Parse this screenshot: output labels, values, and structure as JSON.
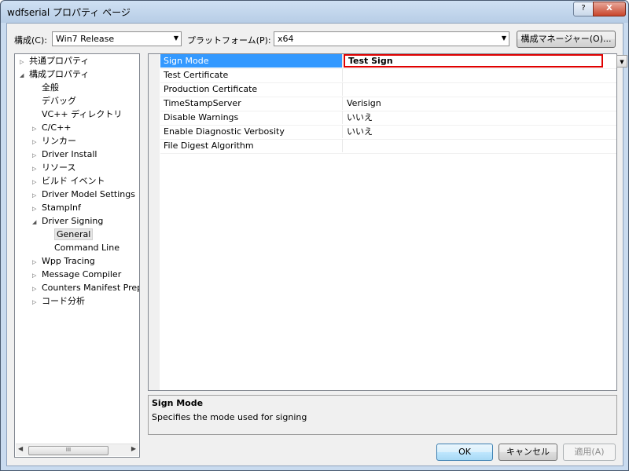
{
  "window": {
    "title": "wdfserial プロパティ ページ",
    "help": "?",
    "close": "X"
  },
  "toolbar": {
    "config_label": "構成(C):",
    "config_value": "Win7 Release",
    "platform_label": "プラットフォーム(P):",
    "platform_value": "x64",
    "config_manager": "構成マネージャー(O)..."
  },
  "tree": {
    "items": [
      {
        "label": "共通プロパティ",
        "twisty": "▷"
      },
      {
        "label": "構成プロパティ",
        "twisty": "◢"
      },
      {
        "label": "全般",
        "twisty": ""
      },
      {
        "label": "デバッグ",
        "twisty": ""
      },
      {
        "label": "VC++ ディレクトリ",
        "twisty": ""
      },
      {
        "label": "C/C++",
        "twisty": "▷"
      },
      {
        "label": "リンカー",
        "twisty": "▷"
      },
      {
        "label": "Driver Install",
        "twisty": "▷"
      },
      {
        "label": "リソース",
        "twisty": "▷"
      },
      {
        "label": "ビルド イベント",
        "twisty": "▷"
      },
      {
        "label": "Driver Model Settings",
        "twisty": "▷"
      },
      {
        "label": "StampInf",
        "twisty": "▷"
      },
      {
        "label": "Driver Signing",
        "twisty": "◢"
      },
      {
        "label": "General",
        "twisty": ""
      },
      {
        "label": "Command Line",
        "twisty": ""
      },
      {
        "label": "Wpp Tracing",
        "twisty": "▷"
      },
      {
        "label": "Message Compiler",
        "twisty": "▷"
      },
      {
        "label": "Counters Manifest Prepr",
        "twisty": "▷"
      },
      {
        "label": "コード分析",
        "twisty": "▷"
      }
    ],
    "scroll_thumb": "III"
  },
  "grid": {
    "rows": [
      {
        "name": "Sign Mode",
        "value": "Test Sign"
      },
      {
        "name": "Test Certificate",
        "value": ""
      },
      {
        "name": "Production Certificate",
        "value": ""
      },
      {
        "name": "TimeStampServer",
        "value": "Verisign"
      },
      {
        "name": "Disable Warnings",
        "value": "いいえ"
      },
      {
        "name": "Enable Diagnostic Verbosity",
        "value": "いいえ"
      },
      {
        "name": "File Digest Algorithm",
        "value": ""
      }
    ]
  },
  "description": {
    "title": "Sign Mode",
    "text": "Specifies the mode used for signing"
  },
  "buttons": {
    "ok": "OK",
    "cancel": "キャンセル",
    "apply": "適用(A)"
  },
  "colors": {
    "selection": "#3399ff",
    "highlight_border": "#e00000"
  }
}
